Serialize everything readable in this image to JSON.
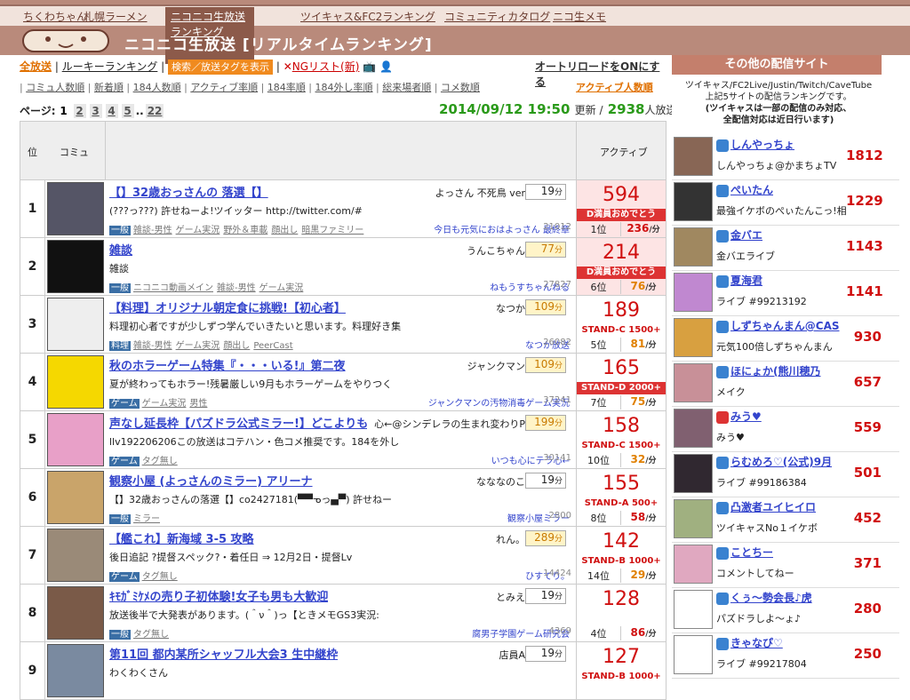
{
  "topnav": [
    {
      "label": "ちくわちゃん",
      "active": false
    },
    {
      "label": "札幌ラーメン",
      "active": false
    },
    {
      "label": "ニコニコ生放送ランキング",
      "active": true
    },
    {
      "label": "ツイキャス&FC2ランキング",
      "active": false
    },
    {
      "label": "コミュニティカタログ",
      "active": false
    },
    {
      "label": "ニコ生メモ",
      "active": false
    }
  ],
  "header": {
    "title": "ニコニコ生放送 [リアルタイムランキング]"
  },
  "filters": {
    "all": "全放送",
    "rookie": "ルーキーランキング",
    "search_btn": "検索／放送タグを表示",
    "ng": "NGリスト(新)",
    "autoreload": "オートリロードをONにする"
  },
  "sorts": [
    {
      "label": "アクティブ人数順",
      "active": true
    },
    {
      "label": "コミュ人数順",
      "active": false
    },
    {
      "label": "新着順",
      "active": false
    },
    {
      "label": "184人数順",
      "active": false
    },
    {
      "label": "アクティブ率順",
      "active": false
    },
    {
      "label": "184率順",
      "active": false
    },
    {
      "label": "184外し率順",
      "active": false
    },
    {
      "label": "総来場者順",
      "active": false
    },
    {
      "label": "コメ数順",
      "active": false
    }
  ],
  "pager": {
    "label": "ページ:",
    "pages": [
      "1",
      "2",
      "3",
      "4",
      "5"
    ],
    "ellipsis": "..",
    "last": "22",
    "current": "1"
  },
  "stamp": {
    "datetime": "2014/09/12 19:50",
    "updated": "更新 /",
    "count": "2938",
    "suffix": "人放送中"
  },
  "table_header": {
    "rank": "位",
    "comm": "コミュ",
    "active": "アクティブ"
  },
  "rows": [
    {
      "rank": "1",
      "title": "【】32歳おっさんの 落選【】",
      "owner": "よっさん 不死鳥 ver",
      "minutes": "19",
      "desc": "(???っ???) 許せねーよ!ツイッター http://twitter.com/#",
      "cat": "一般",
      "tags": [
        "雑談-男性",
        "ゲーム実況",
        "野外＆車載",
        "顔出し",
        "暗黒ファミリー"
      ],
      "community": "今日も元気におはよっさん 最終章",
      "members": "21012",
      "active": "594",
      "badge": "D満員おめでとう",
      "badge_full": true,
      "arank": "1位",
      "speed": "236",
      "hi": false,
      "pink": true,
      "thumb": "#556"
    },
    {
      "rank": "2",
      "title": "雑談",
      "owner": "うんこちゃん",
      "minutes": "77",
      "desc": "雑談",
      "cat": "一般",
      "tags": [
        "ニコニコ動画メイン",
        "雑談-男性",
        "ゲーム実況"
      ],
      "community": "ねもうすちゃんねる",
      "members": "27827",
      "active": "214",
      "badge": "D満員おめでとう",
      "badge_full": true,
      "arank": "6位",
      "speed": "76",
      "hi": true,
      "pink": true,
      "thumb": "#111"
    },
    {
      "rank": "3",
      "title": "【料理】オリジナル朝定食に挑戦!【初心者】",
      "owner": "なつか",
      "minutes": "109",
      "desc": "料理初心者ですが少しずつ学んでいきたいと思います。料理好き集",
      "cat": "料理",
      "tags": [
        "雑談-男性",
        "ゲーム実況",
        "顔出し",
        "PeerCast"
      ],
      "community": "なつか放送",
      "members": "26082",
      "active": "189",
      "badge": "STAND-C 1500+",
      "badge_full": false,
      "arank": "5位",
      "speed": "81",
      "hi": true,
      "pink": false,
      "thumb": "#eee"
    },
    {
      "rank": "4",
      "title": "秋のホラーゲーム特集『・・・いる!』第二夜",
      "owner": "ジャンクマン",
      "minutes": "109",
      "desc": "夏が終わってもホラー!残暑厳しい9月もホラーゲームをやりつく",
      "cat": "ゲーム",
      "tags": [
        "ゲーム実況",
        "男性"
      ],
      "community": "ジャンクマンの汚物消毒ゲーム実況",
      "members": "37241",
      "active": "165",
      "badge": "STAND-D 2000+",
      "badge_full": true,
      "arank": "7位",
      "speed": "75",
      "hi": true,
      "pink": false,
      "thumb": "#f5d800"
    },
    {
      "rank": "5",
      "title": "声なし延長枠【パズドラ公式ミラー!】どこよりも",
      "owner": "心←@シンデレラの生まれ変わりP",
      "minutes": "199",
      "desc": "llv192206206この放送はコテハン・色コメ推奨です。184を外し",
      "cat": "ゲーム",
      "tags": [
        "タグ無し"
      ],
      "community": "いつも心にテラ心←",
      "members": "30141",
      "active": "158",
      "badge": "STAND-C 1500+",
      "badge_full": false,
      "arank": "10位",
      "speed": "32",
      "hi": true,
      "pink": false,
      "thumb": "#e8a0c8"
    },
    {
      "rank": "6",
      "title": "観察小屋 (よっさんのミラー) アリーナ",
      "owner": "なななのこ",
      "minutes": "19",
      "desc": "【】32歳おっさんの落選【】co2427181(▀▀ᓀっ▄▀) 許せねー",
      "cat": "一般",
      "tags": [
        "ミラー"
      ],
      "community": "観察小屋ミラー",
      "members": "2800",
      "active": "155",
      "badge": "STAND-A 500+",
      "badge_full": false,
      "arank": "8位",
      "speed": "58",
      "hi": false,
      "pink": false,
      "thumb": "#c9a46a"
    },
    {
      "rank": "7",
      "title": "【艦これ】新海域 3-5 攻略",
      "owner": "れん。",
      "minutes": "289",
      "desc": "後日追記 ?提督スペック?・着任日 ⇒ 12月2日・提督Lv",
      "cat": "ゲーム",
      "tags": [
        "タグ無し"
      ],
      "community": "ひすてり。",
      "members": "14424",
      "active": "142",
      "badge": "STAND-B 1000+",
      "badge_full": false,
      "arank": "14位",
      "speed": "29",
      "hi": true,
      "pink": false,
      "thumb": "#9a8a78"
    },
    {
      "rank": "8",
      "title": "ｷﾓｶﾞﾐｹﾒの売り子初体験!女子も男も大歓迎",
      "owner": "とみえ",
      "minutes": "19",
      "desc": "放送後半で大発表があります。(＾ν＾)っ【ときメモGS3実況:",
      "cat": "一般",
      "tags": [
        "タグ無し"
      ],
      "community": "腐男子学園ゲーム研究会",
      "members": "4369",
      "active": "128",
      "badge": "",
      "badge_full": false,
      "arank": "4位",
      "speed": "86",
      "hi": false,
      "pink": false,
      "thumb": "#7a5a48"
    },
    {
      "rank": "9",
      "title": "第11回 都内某所シャッフル大会3 生中継枠",
      "owner": "店員A",
      "minutes": "19",
      "desc": "わくわくさん",
      "cat": "",
      "tags": [],
      "community": "",
      "members": "",
      "active": "127",
      "badge": "STAND-B 1000+",
      "badge_full": false,
      "arank": "",
      "speed": "",
      "hi": false,
      "pink": false,
      "thumb": "#7a8aa0"
    }
  ],
  "sidebar": {
    "title": "その他の配信サイト",
    "info1": "ツイキャス/FC2Live/Justin/Twitch/CaveTube",
    "info2": "上記5サイトの配信ランキングです。",
    "info3": "(ツイキャスは一部の配信のみ対応、",
    "info4": "全配信対応は近日行います)",
    "items": [
      {
        "name": "しんやっちょ",
        "sub": "しんやっちょ@かまちょTV",
        "count": "1812",
        "img": "#886655",
        "red": false
      },
      {
        "name": "ぺいたん",
        "sub": "最強イケボのぺぃたんこっ!相",
        "count": "1229",
        "img": "#333",
        "red": false
      },
      {
        "name": "金バエ",
        "sub": "金バエライブ",
        "count": "1143",
        "img": "#a08860",
        "red": false
      },
      {
        "name": "夏海君",
        "sub": "ライブ #99213192",
        "count": "1141",
        "img": "#c088d0",
        "red": false
      },
      {
        "name": "しずちゃんまん@CAS",
        "sub": "元気100倍しずちゃんまん",
        "count": "930",
        "img": "#d8a040",
        "red": false
      },
      {
        "name": "ほにょか(熊川穂乃",
        "sub": "メイク",
        "count": "657",
        "img": "#c89098",
        "red": false
      },
      {
        "name": "みう♥",
        "sub": "みう♥",
        "count": "559",
        "img": "#806070",
        "red": true
      },
      {
        "name": "らむめろ♡(公式)9月",
        "sub": "ライブ #99186384",
        "count": "501",
        "img": "#302830",
        "red": false
      },
      {
        "name": "凸激者ユイヒイロ",
        "sub": "ツイキャスNo１イケボ",
        "count": "452",
        "img": "#a0b080",
        "red": false
      },
      {
        "name": "ことちー",
        "sub": "コメントしてねー",
        "count": "371",
        "img": "#e0a8c0",
        "red": false
      },
      {
        "name": "くぅ～勢会長♪虎",
        "sub": "パズドラしよ～ょ♪",
        "count": "280",
        "img": "#fff",
        "red": false
      },
      {
        "name": "きゃなぴ♡",
        "sub": "ライブ #99217804",
        "count": "250",
        "img": "#fff",
        "red": false
      }
    ]
  }
}
